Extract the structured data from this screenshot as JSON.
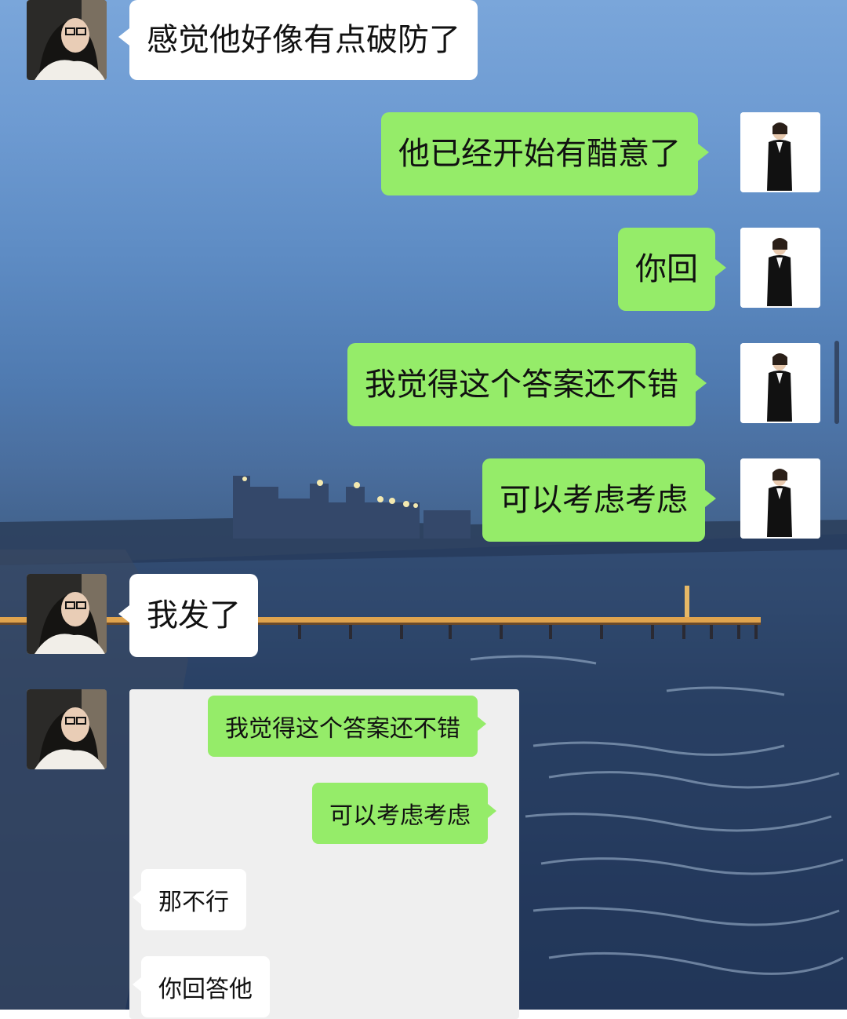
{
  "chat": {
    "messages": [
      {
        "from": "her",
        "text": "感觉他好像有点破防了"
      },
      {
        "from": "me",
        "text": "他已经开始有醋意了"
      },
      {
        "from": "me",
        "text": "你回"
      },
      {
        "from": "me",
        "text": "我觉得这个答案还不错"
      },
      {
        "from": "me",
        "text": "可以考虑考虑"
      },
      {
        "from": "her",
        "text": "我发了"
      }
    ],
    "screenshot": {
      "messages": [
        {
          "from": "me",
          "text": "我觉得这个答案还不错"
        },
        {
          "from": "me",
          "text": "可以考虑考虑"
        },
        {
          "from": "other",
          "text": "那不行"
        },
        {
          "from": "other",
          "text": "你回答他"
        }
      ]
    }
  },
  "colors": {
    "green_bubble": "#95ec69",
    "white_bubble": "#ffffff"
  }
}
